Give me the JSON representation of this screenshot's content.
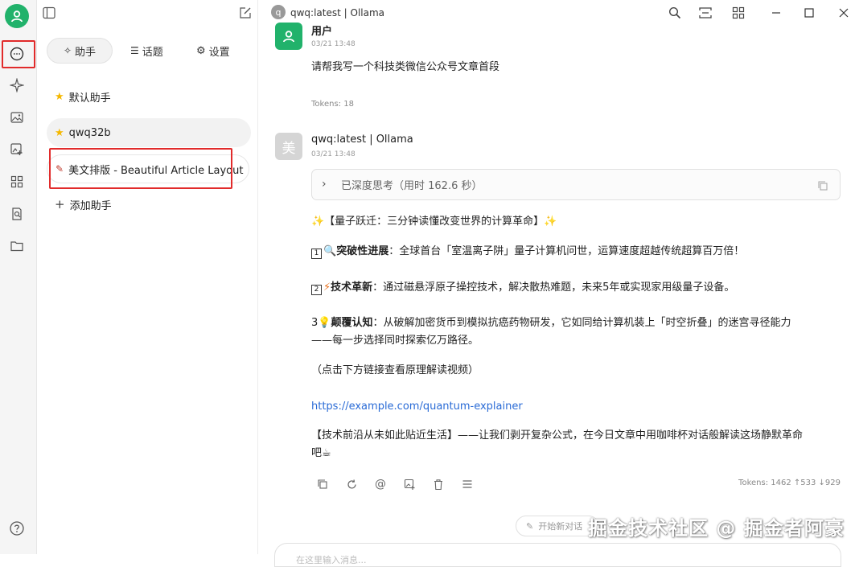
{
  "window": {
    "title": "qwq:latest | Ollama",
    "model_badge": "q"
  },
  "sidebar": {
    "tabs": [
      {
        "label": "助手",
        "icon": "sparkle-icon"
      },
      {
        "label": "话题",
        "icon": "list-icon"
      },
      {
        "label": "设置",
        "icon": "gear-icon"
      }
    ],
    "assistants": [
      {
        "label": "默认助手",
        "icon": "star-emoji"
      },
      {
        "label": "qwq32b",
        "icon": "star-emoji"
      },
      {
        "label": "美文排版 - Beautiful Article Layout",
        "icon": "memo-emoji"
      }
    ],
    "add_label": "添加助手"
  },
  "messages": {
    "user": {
      "name": "用户",
      "time": "03/21 13:48",
      "text": "请帮我写一个科技类微信公众号文章首段",
      "tokens": "Tokens: 18"
    },
    "assistant": {
      "avatar": "美",
      "name": "qwq:latest | Ollama",
      "time": "03/21 13:48",
      "thinking": "已深度思考（用时 162.6 秒）",
      "headline": "✨【量子跃迁：三分钟读懂改变世界的计算革命】✨",
      "p1_num": "1",
      "p1_emoji": "🔍",
      "p1_bold": "突破性进展",
      "p1_text": "：全球首台「室温离子阱」量子计算机问世，运算速度超越传统超算百万倍！",
      "p2_num": "2",
      "p2_emoji": "⚡",
      "p2_bold": "技术革新",
      "p2_text": "：通过磁悬浮原子操控技术，解决散热难题，未来5年或实现家用级量子设备。",
      "p3_num": "3",
      "p3_emoji": "💡",
      "p3_bold": "颠覆认知",
      "p3_text": "：从破解加密货币到模拟抗癌药物研发，它如同给计算机装上「时空折叠」的迷宫寻径能力",
      "p3_text2": "——每一步选择同时探索亿万路径。",
      "note": "（点击下方链接查看原理解读视频）",
      "link": "https://example.com/quantum-explainer",
      "closing": "【技术前沿从未如此贴近生活】——让我们剥开复杂公式，在今日文章中用咖啡杯对话般解读这场静默革命",
      "closing2": "吧☕",
      "tokens": "Tokens: 1462 ↑533 ↓929"
    }
  },
  "footer": {
    "new_topic": "开始新对话",
    "input_placeholder": "在这里输入消息..."
  },
  "watermark": "掘金技术社区 @ 掘金者阿豪",
  "colors": {
    "accent": "#21b26b",
    "highlight": "#e12b2b",
    "link": "#2a6bd6"
  }
}
